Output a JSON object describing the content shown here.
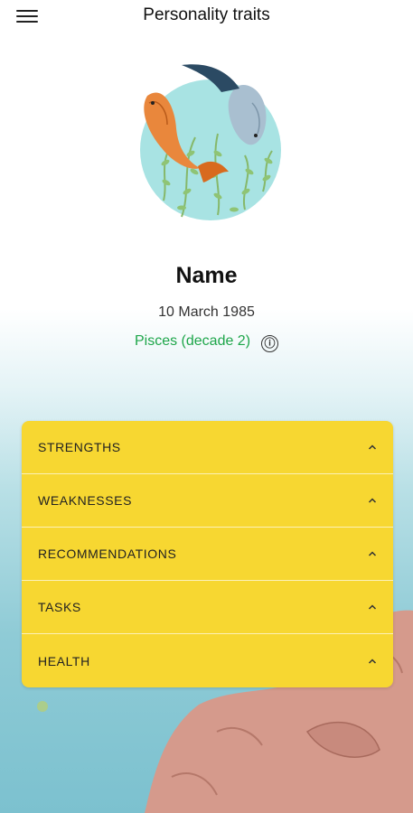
{
  "header": {
    "title": "Personality traits",
    "menu_icon": "hamburger-menu-icon"
  },
  "profile": {
    "name": "Name",
    "birth_date": "10 March 1985",
    "sign": "Pisces (decade 2)",
    "sign_color": "#1ea64a",
    "info_icon": "ⓘ"
  },
  "sections": [
    {
      "label": "STRENGTHS"
    },
    {
      "label": "WEAKNESSES"
    },
    {
      "label": "RECOMMENDATIONS"
    },
    {
      "label": "TASKS"
    },
    {
      "label": "HEALTH"
    }
  ],
  "colors": {
    "accordion": "#f7d731",
    "accent_text": "#1ea64a"
  }
}
